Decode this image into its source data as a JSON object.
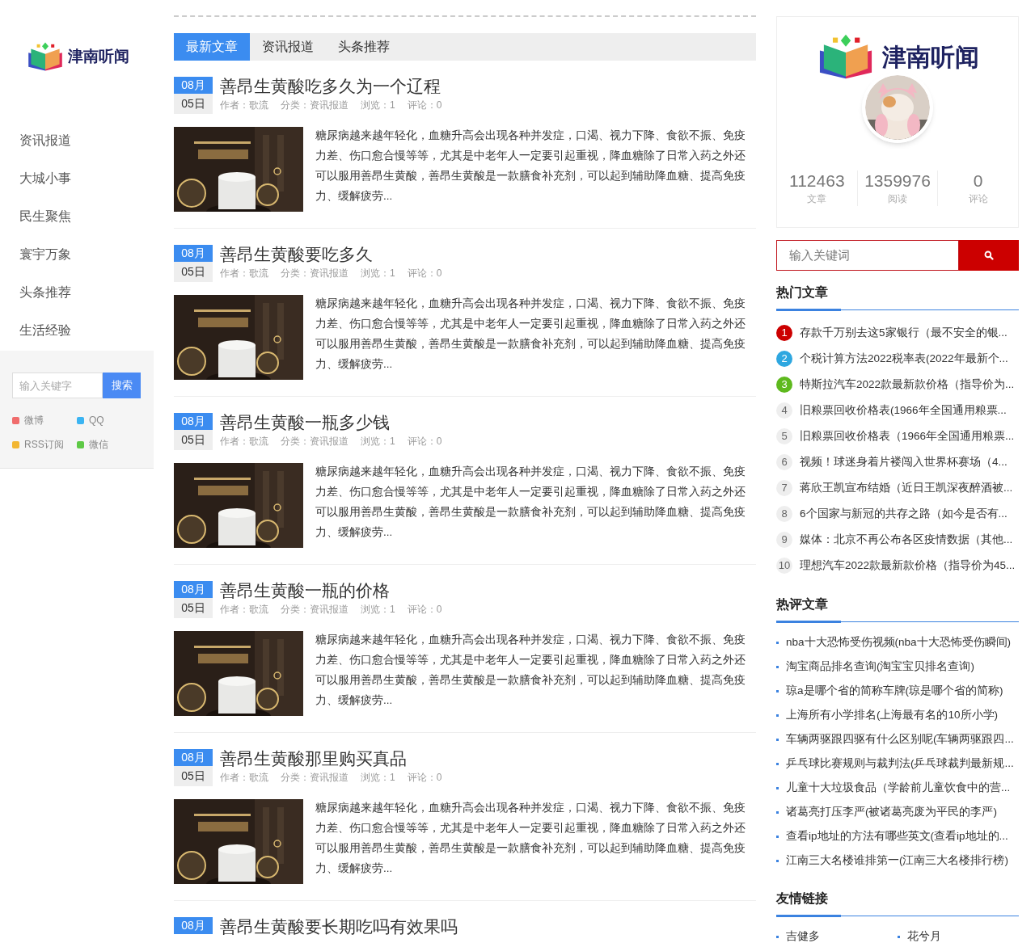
{
  "site": {
    "logo_text": "津南听闻"
  },
  "nav": [
    {
      "label": "资讯报道"
    },
    {
      "label": "大城小事"
    },
    {
      "label": "民生聚焦"
    },
    {
      "label": "寰宇万象"
    },
    {
      "label": "头条推荐"
    },
    {
      "label": "生活经验"
    }
  ],
  "side_search": {
    "placeholder": "输入关键字",
    "button": "搜索"
  },
  "social": [
    {
      "label": "微博",
      "color": "#f06c6c"
    },
    {
      "label": "QQ",
      "color": "#3bb4f2"
    },
    {
      "label": "RSS订阅",
      "color": "#f2b632"
    },
    {
      "label": "微信",
      "color": "#5ec946"
    }
  ],
  "tabs": [
    {
      "label": "最新文章",
      "selected": true
    },
    {
      "label": "资讯报道",
      "selected": false
    },
    {
      "label": "头条推荐",
      "selected": false
    }
  ],
  "articles": [
    {
      "month": "08月",
      "day": "05日",
      "title": "善昂生黄酸吃多久为一个辽程",
      "meta": [
        "作者：歌流",
        "分类：资讯报道",
        "浏览：1",
        "评论：0"
      ],
      "excerpt": "糖尿病越来越年轻化，血糖升高会出现各种并发症，口渴、视力下降、食欲不振、免疫力差、伤口愈合慢等等，尤其是中老年人一定要引起重视，降血糖除了日常入药之外还可以服用善昂生黄酸，善昂生黄酸是一款膳食补充剂，可以起到辅助降血糖、提高免疫力、缓解疲劳..."
    },
    {
      "month": "08月",
      "day": "05日",
      "title": "善昂生黄酸要吃多久",
      "meta": [
        "作者：歌流",
        "分类：资讯报道",
        "浏览：1",
        "评论：0"
      ],
      "excerpt": "糖尿病越来越年轻化，血糖升高会出现各种并发症，口渴、视力下降、食欲不振、免疫力差、伤口愈合慢等等，尤其是中老年人一定要引起重视，降血糖除了日常入药之外还可以服用善昂生黄酸，善昂生黄酸是一款膳食补充剂，可以起到辅助降血糖、提高免疫力、缓解疲劳..."
    },
    {
      "month": "08月",
      "day": "05日",
      "title": "善昂生黄酸一瓶多少钱",
      "meta": [
        "作者：歌流",
        "分类：资讯报道",
        "浏览：1",
        "评论：0"
      ],
      "excerpt": "糖尿病越来越年轻化，血糖升高会出现各种并发症，口渴、视力下降、食欲不振、免疫力差、伤口愈合慢等等，尤其是中老年人一定要引起重视，降血糖除了日常入药之外还可以服用善昂生黄酸，善昂生黄酸是一款膳食补充剂，可以起到辅助降血糖、提高免疫力、缓解疲劳..."
    },
    {
      "month": "08月",
      "day": "05日",
      "title": "善昂生黄酸一瓶的价格",
      "meta": [
        "作者：歌流",
        "分类：资讯报道",
        "浏览：1",
        "评论：0"
      ],
      "excerpt": "糖尿病越来越年轻化，血糖升高会出现各种并发症，口渴、视力下降、食欲不振、免疫力差、伤口愈合慢等等，尤其是中老年人一定要引起重视，降血糖除了日常入药之外还可以服用善昂生黄酸，善昂生黄酸是一款膳食补充剂，可以起到辅助降血糖、提高免疫力、缓解疲劳..."
    },
    {
      "month": "08月",
      "day": "05日",
      "title": "善昂生黄酸那里购买真品",
      "meta": [
        "作者：歌流",
        "分类：资讯报道",
        "浏览：1",
        "评论：0"
      ],
      "excerpt": "糖尿病越来越年轻化，血糖升高会出现各种并发症，口渴、视力下降、食欲不振、免疫力差、伤口愈合慢等等，尤其是中老年人一定要引起重视，降血糖除了日常入药之外还可以服用善昂生黄酸，善昂生黄酸是一款膳食补充剂，可以起到辅助降血糖、提高免疫力、缓解疲劳..."
    },
    {
      "month": "08月",
      "title": "善昂生黄酸要长期吃吗有效果吗"
    }
  ],
  "profile": {
    "logo_text": "津南听闻",
    "stats": [
      {
        "value": "112463",
        "label": "文章"
      },
      {
        "value": "1359976",
        "label": "阅读"
      },
      {
        "value": "0",
        "label": "评论"
      }
    ]
  },
  "search": {
    "placeholder": "输入关键词"
  },
  "hot": {
    "title": "热门文章",
    "items": [
      {
        "rank": "1",
        "title": "存款千万别去这5家银行（最不安全的银...",
        "color": "#cc0000"
      },
      {
        "rank": "2",
        "title": "个税计算方法2022税率表(2022年最新个...",
        "color": "#2ea7e0"
      },
      {
        "rank": "3",
        "title": "特斯拉汽车2022款最新款价格（指导价为...",
        "color": "#5eb91e"
      },
      {
        "rank": "4",
        "title": "旧粮票回收价格表(1966年全国通用粮票...",
        "color": "#eeeeee"
      },
      {
        "rank": "5",
        "title": "旧粮票回收价格表（1966年全国通用粮票...",
        "color": "#eeeeee"
      },
      {
        "rank": "6",
        "title": "视频！球迷身着片褛闯入世界杯赛场（4...",
        "color": "#eeeeee"
      },
      {
        "rank": "7",
        "title": "蒋欣王凯宣布结婚（近日王凯深夜醉酒被...",
        "color": "#eeeeee"
      },
      {
        "rank": "8",
        "title": "6个国家与新冠的共存之路（如今是否有...",
        "color": "#eeeeee"
      },
      {
        "rank": "9",
        "title": "媒体：北京不再公布各区疫情数据（其他...",
        "color": "#eeeeee"
      },
      {
        "rank": "10",
        "title": "理想汽车2022款最新款价格（指导价为45...",
        "color": "#eeeeee"
      }
    ]
  },
  "commented": {
    "title": "热评文章",
    "items": [
      "nba十大恐怖受伤视频(nba十大恐怖受伤瞬间)",
      "淘宝商品排名查询(淘宝宝贝排名查询)",
      "琼a是哪个省的简称车牌(琼是哪个省的简称)",
      "上海所有小学排名(上海最有名的10所小学)",
      "车辆两驱跟四驱有什么区别呢(车辆两驱跟四...",
      "乒乓球比赛规则与裁判法(乒乓球裁判最新规...",
      "儿童十大垃圾食品（学龄前儿童饮食中的营...",
      "诸葛亮打压李严(被诸葛亮废为平民的李严)",
      "查看ip地址的方法有哪些英文(查看ip地址的...",
      "江南三大名楼谁排第一(江南三大名楼排行榜)"
    ]
  },
  "links": {
    "title": "友情链接",
    "items": [
      "吉健多",
      "花兮月"
    ]
  }
}
